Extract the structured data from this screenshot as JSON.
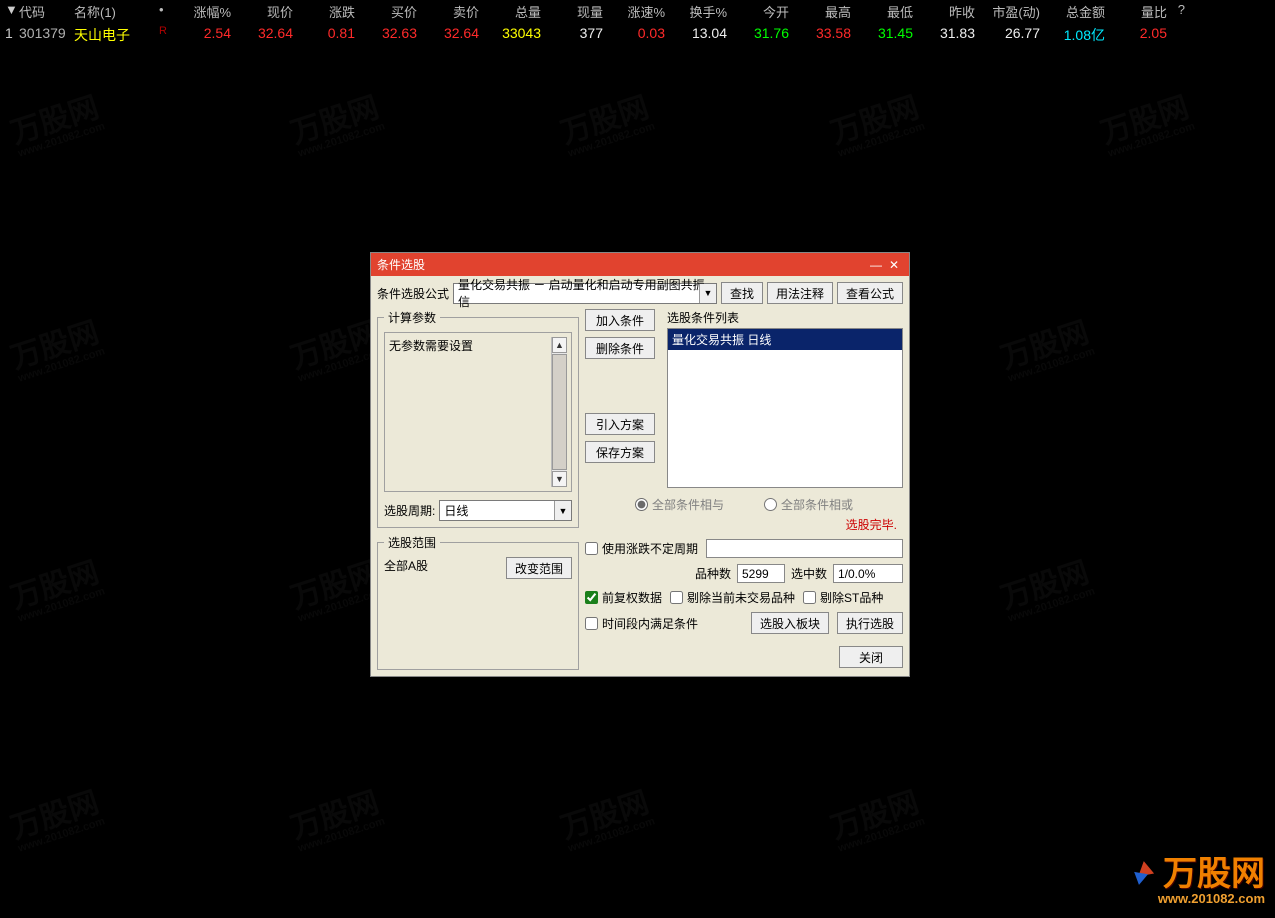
{
  "table": {
    "headers": [
      "代码",
      "名称(1)",
      "涨幅%",
      "现价",
      "涨跌",
      "买价",
      "卖价",
      "总量",
      "现量",
      "涨速%",
      "换手%",
      "今开",
      "最高",
      "最低",
      "昨收",
      "市盈(动)",
      "总金额",
      "量比",
      "?"
    ],
    "sort_indicator": "▼",
    "bullet": "•",
    "row": {
      "idx": "1",
      "code": "301379",
      "name": "天山电子",
      "tag": "R",
      "pct": "2.54",
      "price": "32.64",
      "chg": "0.81",
      "bid": "32.63",
      "ask": "32.64",
      "vol": "33043",
      "cur": "377",
      "speed": "0.03",
      "turnover": "13.04",
      "open": "31.76",
      "high": "33.58",
      "low": "31.45",
      "prev": "31.83",
      "pe": "26.77",
      "amount": "1.08亿",
      "volratio": "2.05"
    }
  },
  "dialog": {
    "title": "条件选股",
    "formula_label": "条件选股公式",
    "formula_value": "量化交易共振 － 启动量化和启动专用副图共振信",
    "find_btn": "查找",
    "usage_btn": "用法注释",
    "view_btn": "查看公式",
    "params_legend": "计算参数",
    "params_msg": "无参数需要设置",
    "period_label": "选股周期:",
    "period_value": "日线",
    "range_legend": "选股范围",
    "range_value": "全部A股",
    "range_btn": "改变范围",
    "add_btn": "加入条件",
    "del_btn": "删除条件",
    "import_btn": "引入方案",
    "save_btn": "保存方案",
    "condlist_label": "选股条件列表",
    "conditem": "量化交易共振  日线",
    "radio_and": "全部条件相与",
    "radio_or": "全部条件相或",
    "status": "选股完毕.",
    "use_period_cb": "使用涨跌不定周期",
    "variety_label": "品种数",
    "variety_value": "5299",
    "selected_label": "选中数",
    "selected_value": "1/0.0%",
    "cb_qfq": "前复权数据",
    "cb_exclude_notrade": "剔除当前未交易品种",
    "cb_exclude_st": "剔除ST品种",
    "cb_timerange": "时间段内满足条件",
    "to_block_btn": "选股入板块",
    "exec_btn": "执行选股",
    "close_btn": "关闭"
  },
  "corner": {
    "text": "万股网",
    "url": "www.201082.com"
  },
  "watermark": {
    "text": "万股网",
    "url": "www.201082.com"
  }
}
